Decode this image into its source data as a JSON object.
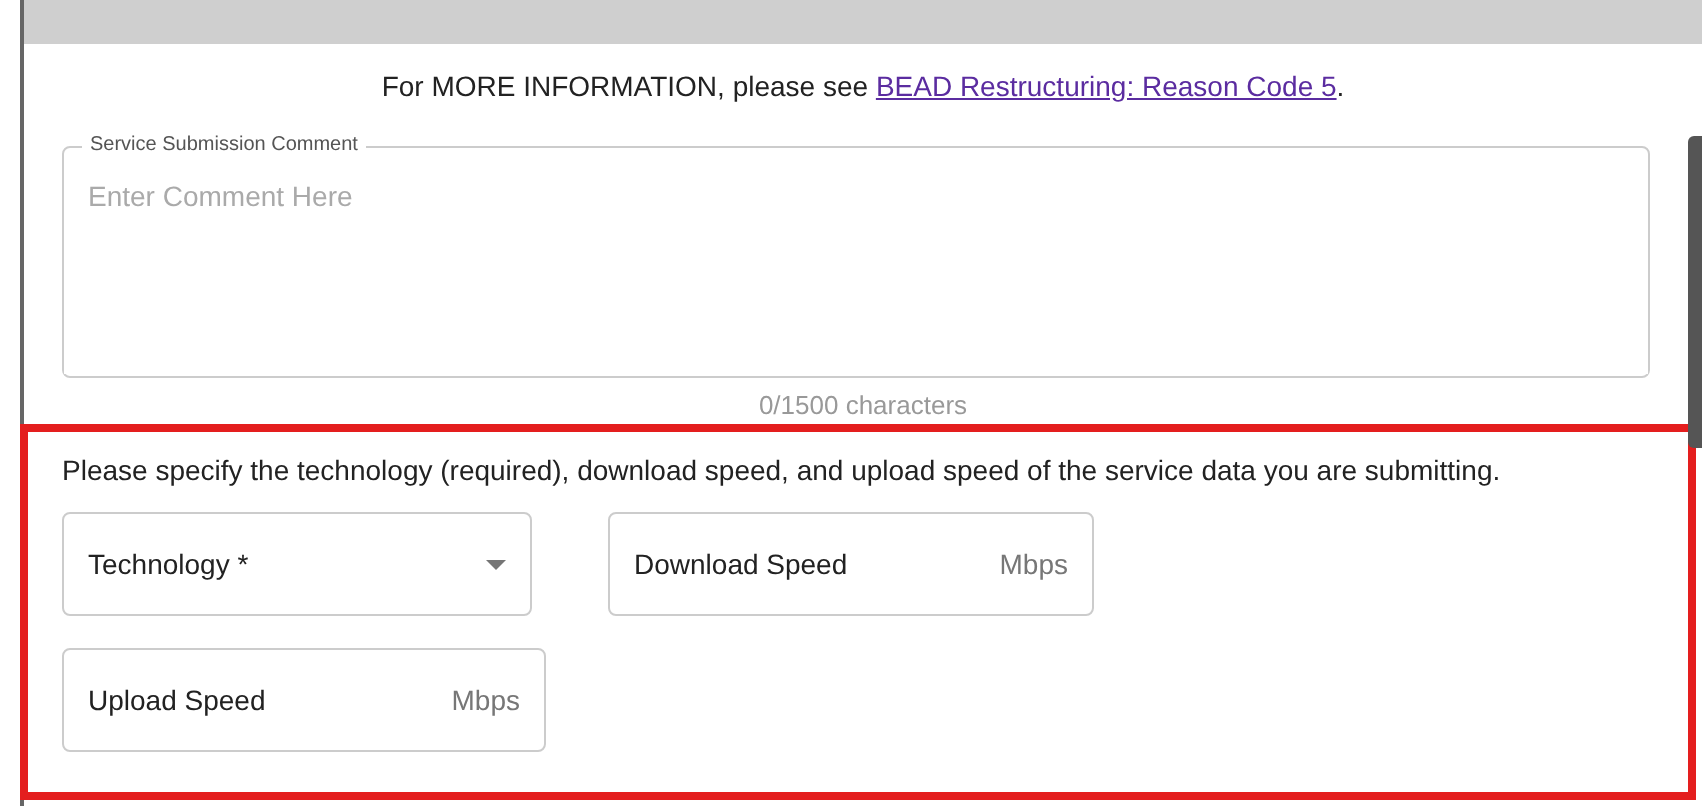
{
  "notice": {
    "text": "For MORE INFORMATION, please see ",
    "link": "BEAD Restructuring: Reason Code 5",
    "end": "."
  },
  "comment": {
    "label": "Service Submission Comment",
    "placeholder": "Enter Comment Here",
    "counter": "0/1500 characters"
  },
  "highlight": {
    "instructions": "Please specify the technology (required), download speed, and upload speed of the service data you are submitting.",
    "fields": [
      {
        "kind": "select",
        "label": "Technology *"
      },
      {
        "kind": "number",
        "label": "Download Speed",
        "unit": "Mbps"
      },
      {
        "kind": "number",
        "label": "Upload Speed",
        "unit": "Mbps"
      }
    ]
  }
}
